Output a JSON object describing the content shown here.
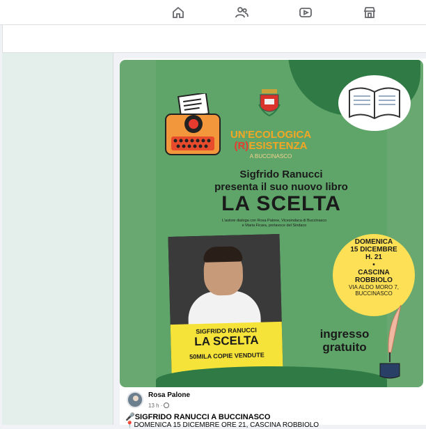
{
  "nav": {
    "items": [
      {
        "icon": "home-icon"
      },
      {
        "icon": "friends-icon"
      },
      {
        "icon": "video-icon"
      },
      {
        "icon": "marketplace-icon"
      }
    ]
  },
  "poster": {
    "headline_line1": "UN'ECOLOGICA",
    "headline_r": "(R)",
    "headline_line2": "ESISTENZA",
    "subheadline": "A BUCCINASCO",
    "author_line1": "Sigfrido Ranucci",
    "author_line2": "presenta il suo nuovo libro",
    "book_title": "LA SCELTA",
    "dialog_line1": "L'autore dialoga con Rosa Palone, Vicesindaca di Buccinasco",
    "dialog_line2": "e Maria Ficara, portavoce del Sindaco",
    "cover_author": "SIGFRIDO RANUCCI",
    "cover_title": "LA SCELTA",
    "cover_copies": "50MILA COPIE VENDUTE",
    "date_day": "DOMENICA",
    "date_date": "15 DICEMBRE",
    "date_time": "H. 21",
    "date_bullet": "•",
    "venue_line1": "CASCINA",
    "venue_line2": "ROBBIOLO",
    "address_line1": "VIA ALDO MORO 7,",
    "address_line2": "BUCCINASCO",
    "entry_line1": "ingresso",
    "entry_line2": "gratuito"
  },
  "post": {
    "author": "Rosa Palone",
    "time": "13 h ·",
    "text_line1": "🎤SIGFRIDO RANUCCI A  BUCCINASCO",
    "text_line2": "📍DOMENICA 15 DICEMBRE ORE 21, CASCINA ROBBIOLO"
  },
  "colors": {
    "poster_green": "#5fa56a",
    "dark_green": "#2f7a45",
    "headline_orange": "#f5a623",
    "date_yellow": "#fde055"
  }
}
